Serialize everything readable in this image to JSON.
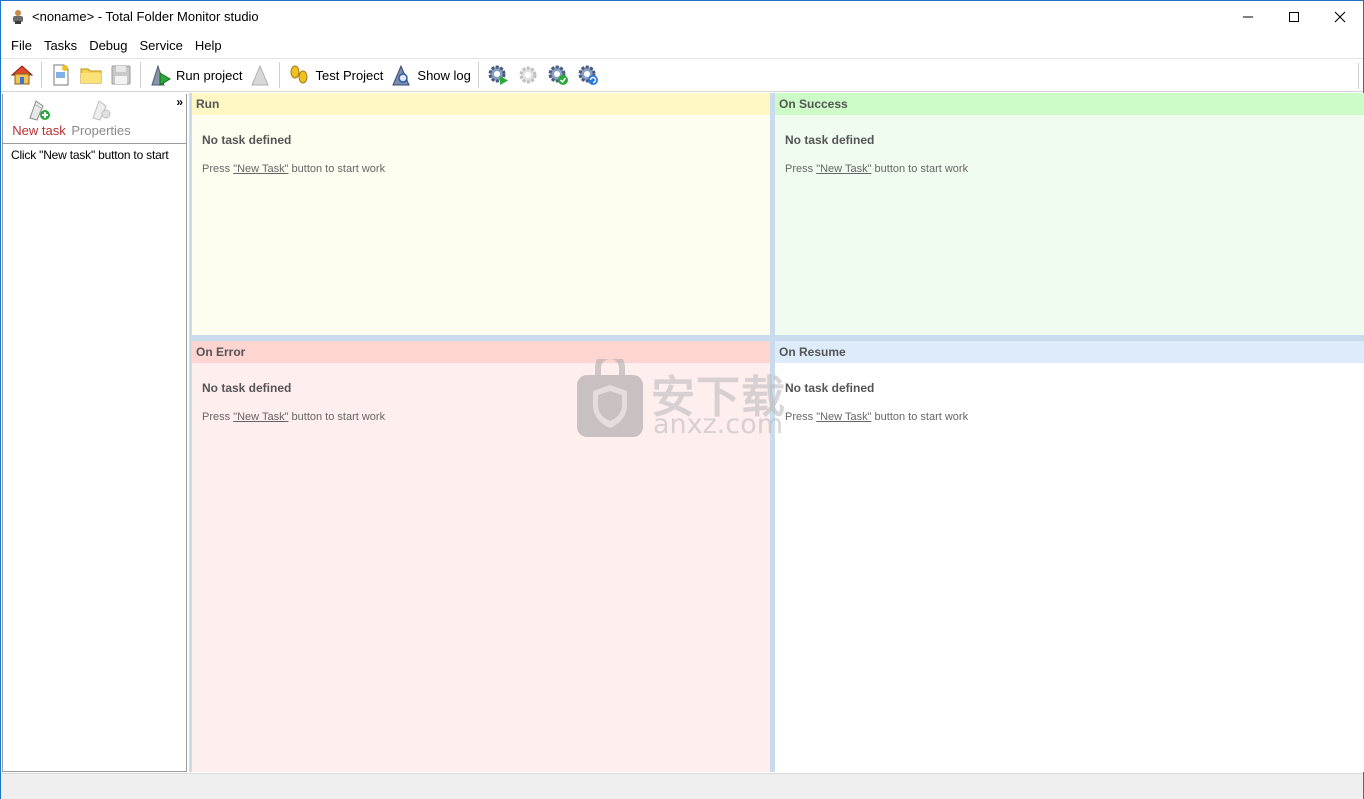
{
  "window": {
    "title": "<noname> - Total Folder Monitor studio"
  },
  "menu": {
    "items": [
      "File",
      "Tasks",
      "Debug",
      "Service",
      "Help"
    ]
  },
  "toolbar": {
    "run_project": "Run project",
    "test_project": "Test Project",
    "show_log": "Show log"
  },
  "left_panel": {
    "new_task": "New task",
    "properties": "Properties",
    "collapse": "»",
    "hint": "Click \"New task\" button to start"
  },
  "panes": {
    "run": {
      "header": "Run",
      "title": "No task defined",
      "desc_pre": "Press ",
      "desc_link": "\"New Task\"",
      "desc_post": " button to start work"
    },
    "success": {
      "header": "On Success",
      "title": "No task defined",
      "desc_pre": "Press ",
      "desc_link": "\"New Task\"",
      "desc_post": " button to start work"
    },
    "error": {
      "header": "On Error",
      "title": "No task defined",
      "desc_pre": "Press ",
      "desc_link": "\"New Task\"",
      "desc_post": " button to start work"
    },
    "resume": {
      "header": "On Resume",
      "title": "No task defined",
      "desc_pre": "Press ",
      "desc_link": "\"New Task\"",
      "desc_post": " button to start work"
    }
  },
  "watermark": {
    "cn": "安下载",
    "en": "anxz.com"
  },
  "colors": {
    "run_header": "#fff7c4",
    "success_header": "#cdfcc9",
    "error_header": "#ffd5d2",
    "resume_header": "#deebfb",
    "new_task_label": "#b83232"
  }
}
